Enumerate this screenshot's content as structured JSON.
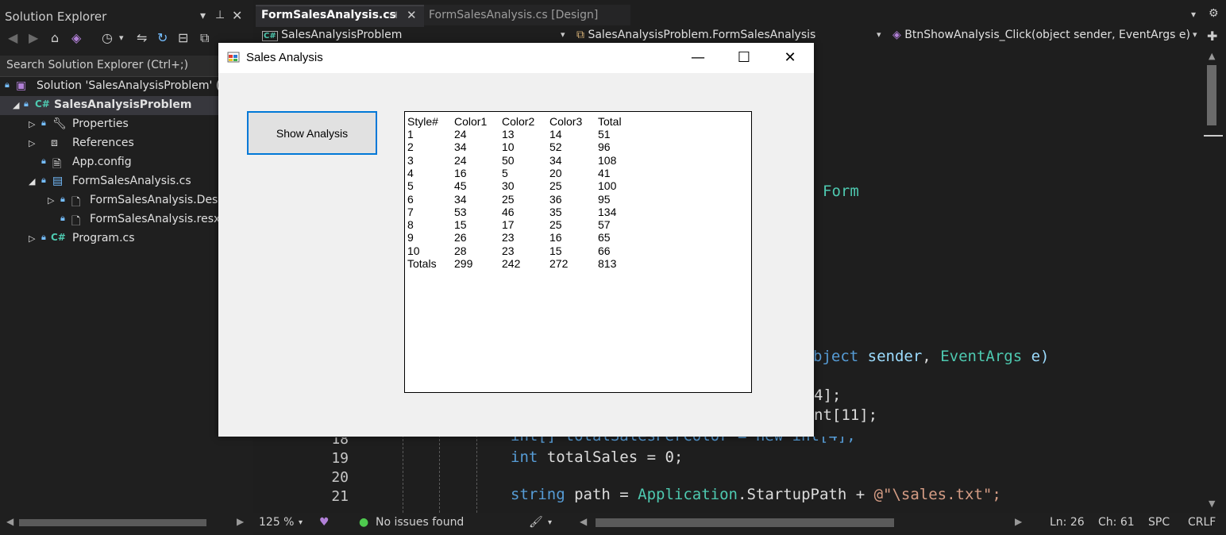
{
  "solution_explorer": {
    "title": "Solution Explorer",
    "search_placeholder": "Search Solution Explorer (Ctrl+;)",
    "tree": [
      {
        "label": "Solution 'SalesAnalysisProblem' (1"
      },
      {
        "label": "SalesAnalysisProblem"
      },
      {
        "label": "Properties"
      },
      {
        "label": "References"
      },
      {
        "label": "App.config"
      },
      {
        "label": "FormSalesAnalysis.cs"
      },
      {
        "label": "FormSalesAnalysis.Desig"
      },
      {
        "label": "FormSalesAnalysis.resx"
      },
      {
        "label": "Program.cs"
      }
    ]
  },
  "editor": {
    "tabs": [
      {
        "label": "FormSalesAnalysis.cs"
      },
      {
        "label": "FormSalesAnalysis.cs [Design]"
      }
    ],
    "nav": {
      "project": "SalesAnalysisProblem",
      "class": "SalesAnalysisProblem.FormSalesAnalysis",
      "member": "BtnShowAnalysis_Click(object sender, EventArgs e)"
    },
    "line_numbers": [
      "18",
      "19",
      "20",
      "21"
    ],
    "code_fragments": {
      "form_word": "Form",
      "sig_a": "bject",
      "sig_b": "sender",
      "sig_c": "EventArgs",
      "sig_d": "e)",
      "arr1": "4];",
      "arr2": "nt[11];",
      "line18": "int[] totalSalesPerColor = new int[4];",
      "line19_kw": "int",
      "line19_rest": "totalSales = 0;",
      "line21_kw": "string",
      "line21_mid": "path = ",
      "line21_ty": "Application",
      "line21_prop": ".StartupPath + ",
      "line21_str": "@\"\\sales.txt\";"
    },
    "status": {
      "zoom": "125 %",
      "issues": "No issues found",
      "line": "Ln: 26",
      "col": "Ch: 61",
      "spc": "SPC",
      "eol": "CRLF"
    }
  },
  "form": {
    "title": "Sales Analysis",
    "button_label": "Show Analysis",
    "table": {
      "headers": [
        "Style#",
        "Color1",
        "Color2",
        "Color3",
        "Total"
      ],
      "rows": [
        [
          "1",
          "24",
          "13",
          "14",
          "51"
        ],
        [
          "2",
          "34",
          "10",
          "52",
          "96"
        ],
        [
          "3",
          "24",
          "50",
          "34",
          "108"
        ],
        [
          "4",
          "16",
          "5",
          "20",
          "41"
        ],
        [
          "5",
          "45",
          "30",
          "25",
          "100"
        ],
        [
          "6",
          "34",
          "25",
          "36",
          "95"
        ],
        [
          "7",
          "53",
          "46",
          "35",
          "134"
        ],
        [
          "8",
          "15",
          "17",
          "25",
          "57"
        ],
        [
          "9",
          "26",
          "23",
          "16",
          "65"
        ],
        [
          "10",
          "28",
          "23",
          "15",
          "66"
        ],
        [
          "Totals",
          "299",
          "242",
          "272",
          "813"
        ]
      ]
    }
  }
}
